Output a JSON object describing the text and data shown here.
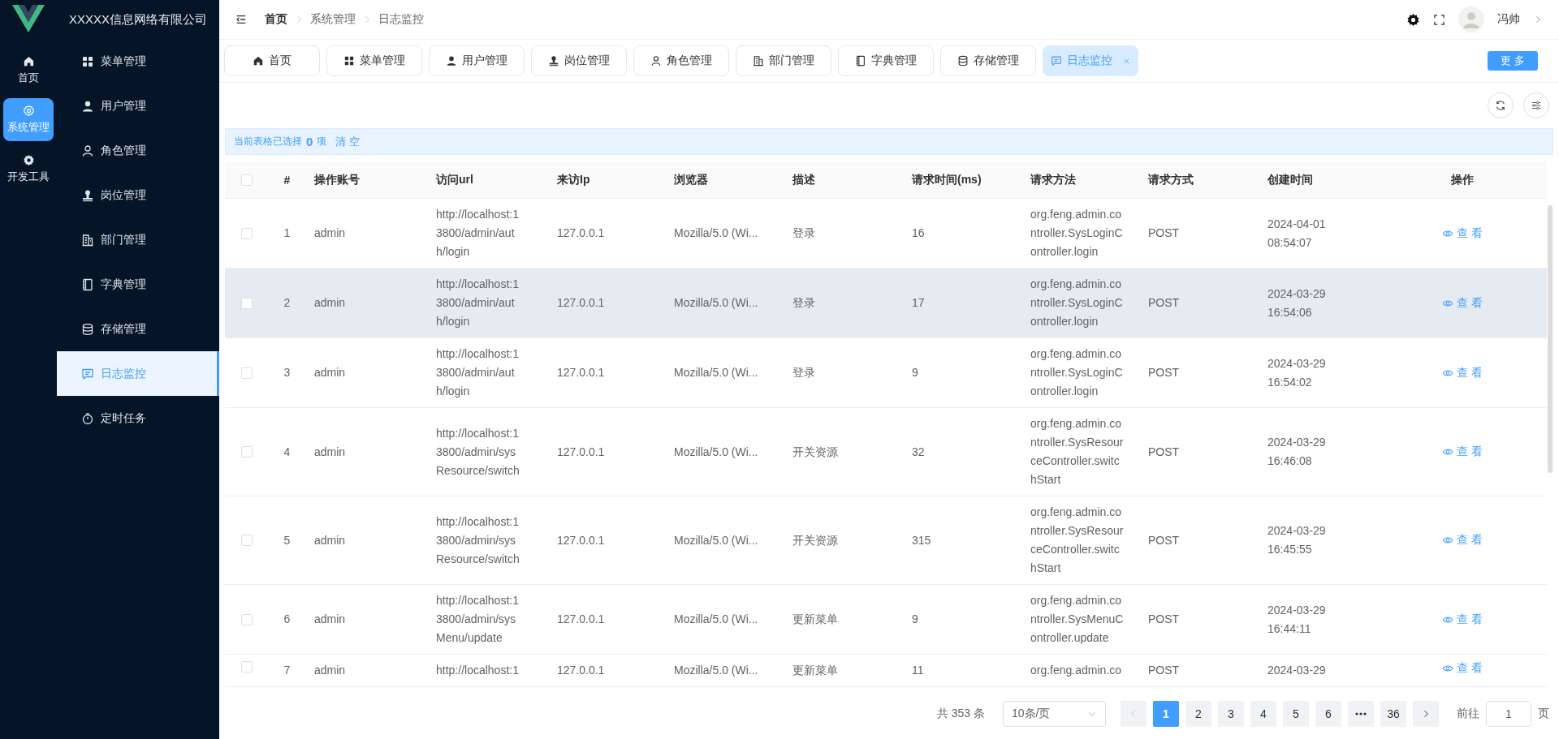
{
  "brand": {
    "name": "XXXXX信息网络有限公司"
  },
  "rail": [
    {
      "label": "首页",
      "selected": false
    },
    {
      "label": "系统管理",
      "selected": true
    },
    {
      "label": "开发工具",
      "selected": false
    }
  ],
  "menu": [
    {
      "label": "菜单管理",
      "selected": false
    },
    {
      "label": "用户管理",
      "selected": false
    },
    {
      "label": "角色管理",
      "selected": false
    },
    {
      "label": "岗位管理",
      "selected": false
    },
    {
      "label": "部门管理",
      "selected": false
    },
    {
      "label": "字典管理",
      "selected": false
    },
    {
      "label": "存储管理",
      "selected": false
    },
    {
      "label": "日志监控",
      "selected": true
    },
    {
      "label": "定时任务",
      "selected": false
    }
  ],
  "breadcrumb": [
    "首页",
    "系统管理",
    "日志监控"
  ],
  "user": {
    "name": "冯帅"
  },
  "tabs": [
    {
      "label": "首页",
      "selected": false
    },
    {
      "label": "菜单管理",
      "selected": false
    },
    {
      "label": "用户管理",
      "selected": false
    },
    {
      "label": "岗位管理",
      "selected": false
    },
    {
      "label": "角色管理",
      "selected": false
    },
    {
      "label": "部门管理",
      "selected": false
    },
    {
      "label": "字典管理",
      "selected": false
    },
    {
      "label": "存储管理",
      "selected": false
    },
    {
      "label": "日志监控",
      "selected": true
    }
  ],
  "more_button": "更 多",
  "selection_bar": {
    "prefix": "当前表格已选择",
    "count": "0",
    "suffix": "项",
    "clear": "清 空"
  },
  "table": {
    "header_checked": false,
    "columns": [
      "#",
      "操作账号",
      "访问url",
      "来访Ip",
      "浏览器",
      "描述",
      "请求时间(ms)",
      "请求方法",
      "请求方式",
      "创建时间",
      "操作"
    ],
    "rows": [
      {
        "checked": false,
        "selected": false,
        "cells": [
          "1",
          "admin",
          "http://localhost:13800/admin/auth/login",
          "127.0.0.1",
          "Mozilla/5.0 (Wi...",
          "登录",
          "16",
          "org.feng.admin.controller.SysLoginController.login",
          "POST",
          "2024-04-01 08:54:07"
        ],
        "action": "查 看"
      },
      {
        "checked": false,
        "selected": true,
        "cells": [
          "2",
          "admin",
          "http://localhost:13800/admin/auth/login",
          "127.0.0.1",
          "Mozilla/5.0 (Wi...",
          "登录",
          "17",
          "org.feng.admin.controller.SysLoginController.login",
          "POST",
          "2024-03-29 16:54:06"
        ],
        "action": "查 看"
      },
      {
        "checked": false,
        "selected": false,
        "cells": [
          "3",
          "admin",
          "http://localhost:13800/admin/auth/login",
          "127.0.0.1",
          "Mozilla/5.0 (Wi...",
          "登录",
          "9",
          "org.feng.admin.controller.SysLoginController.login",
          "POST",
          "2024-03-29 16:54:02"
        ],
        "action": "查 看"
      },
      {
        "checked": false,
        "selected": false,
        "cells": [
          "4",
          "admin",
          "http://localhost:13800/admin/sysResource/switch",
          "127.0.0.1",
          "Mozilla/5.0 (Wi...",
          "开关资源",
          "32",
          "org.feng.admin.controller.SysResourceController.switchStart",
          "POST",
          "2024-03-29 16:46:08"
        ],
        "action": "查 看"
      },
      {
        "checked": false,
        "selected": false,
        "cells": [
          "5",
          "admin",
          "http://localhost:13800/admin/sysResource/switch",
          "127.0.0.1",
          "Mozilla/5.0 (Wi...",
          "开关资源",
          "315",
          "org.feng.admin.controller.SysResourceController.switchStart",
          "POST",
          "2024-03-29 16:45:55"
        ],
        "action": "查 看"
      },
      {
        "checked": false,
        "selected": false,
        "cells": [
          "6",
          "admin",
          "http://localhost:13800/admin/sysMenu/update",
          "127.0.0.1",
          "Mozilla/5.0 (Wi...",
          "更新菜单",
          "9",
          "org.feng.admin.controller.SysMenuController.update",
          "POST",
          "2024-03-29 16:44:11"
        ],
        "action": "查 看"
      },
      {
        "checked": false,
        "selected": false,
        "cells": [
          "7",
          "admin",
          "http://localhost:1",
          "127.0.0.1",
          "Mozilla/5.0 (Wi...",
          "更新菜单",
          "11",
          "org.feng.admin.co",
          "POST",
          "2024-03-29"
        ],
        "action": "查 看"
      }
    ]
  },
  "pagination": {
    "total": "共 353 条",
    "page_size": "10条/页",
    "pages": [
      {
        "kind": "page",
        "label": "1",
        "selected": true
      },
      {
        "kind": "page",
        "label": "2",
        "selected": false
      },
      {
        "kind": "page",
        "label": "3",
        "selected": false
      },
      {
        "kind": "page",
        "label": "4",
        "selected": false
      },
      {
        "kind": "page",
        "label": "5",
        "selected": false
      },
      {
        "kind": "page",
        "label": "6",
        "selected": false
      },
      {
        "kind": "ellipsis",
        "selected": false
      },
      {
        "kind": "page",
        "label": "36",
        "selected": false
      }
    ],
    "goto_label": "前往",
    "goto_value": "1",
    "page_unit": "页"
  }
}
